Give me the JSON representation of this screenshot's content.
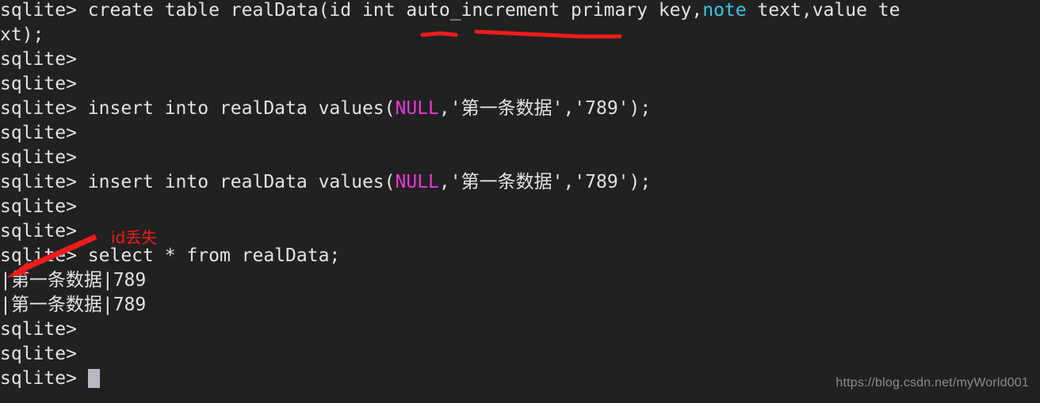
{
  "terminal": {
    "background_color": "#212121",
    "text_color": "#e3e3e3",
    "prompt": "sqlite>",
    "cursor": {
      "name": "text-cursor-block",
      "color": "#b8b8c4"
    },
    "colors": {
      "keyword_cyan": "#34c8e8",
      "literal_magenta": "#e838d8",
      "annotation_red": "#ee1c1c",
      "watermark_gray": "#8c8c8c"
    },
    "lines": [
      {
        "id": "line-1",
        "segments": [
          {
            "text": "sqlite> create table realData(id int auto_increment primary key,",
            "color": "plain"
          },
          {
            "text": "note",
            "color": "cyan"
          },
          {
            "text": " text,value te",
            "color": "plain"
          }
        ]
      },
      {
        "id": "line-2",
        "segments": [
          {
            "text": "xt);",
            "color": "plain"
          }
        ]
      },
      {
        "id": "line-3",
        "segments": [
          {
            "text": "sqlite>",
            "color": "plain"
          }
        ]
      },
      {
        "id": "line-4",
        "segments": [
          {
            "text": "sqlite>",
            "color": "plain"
          }
        ]
      },
      {
        "id": "line-5",
        "segments": [
          {
            "text": "sqlite> insert into realData values(",
            "color": "plain"
          },
          {
            "text": "NULL",
            "color": "magenta"
          },
          {
            "text": ",'第一条数据','789');",
            "color": "plain"
          }
        ]
      },
      {
        "id": "line-6",
        "segments": [
          {
            "text": "sqlite>",
            "color": "plain"
          }
        ]
      },
      {
        "id": "line-7",
        "segments": [
          {
            "text": "sqlite>",
            "color": "plain"
          }
        ]
      },
      {
        "id": "line-8",
        "segments": [
          {
            "text": "sqlite> insert into realData values(",
            "color": "plain"
          },
          {
            "text": "NULL",
            "color": "magenta"
          },
          {
            "text": ",'第一条数据','789');",
            "color": "plain"
          }
        ]
      },
      {
        "id": "line-9",
        "segments": [
          {
            "text": "sqlite>",
            "color": "plain"
          }
        ]
      },
      {
        "id": "line-10",
        "segments": [
          {
            "text": "sqlite>",
            "color": "plain"
          }
        ]
      },
      {
        "id": "line-11",
        "segments": [
          {
            "text": "sqlite> select * from realData;",
            "color": "plain"
          }
        ]
      },
      {
        "id": "line-12",
        "segments": [
          {
            "text": "|第一条数据|789",
            "color": "plain"
          }
        ]
      },
      {
        "id": "line-13",
        "segments": [
          {
            "text": "|第一条数据|789",
            "color": "plain"
          }
        ]
      },
      {
        "id": "line-14",
        "segments": [
          {
            "text": "sqlite>",
            "color": "plain"
          }
        ]
      },
      {
        "id": "line-15",
        "segments": [
          {
            "text": "sqlite>",
            "color": "plain"
          }
        ]
      },
      {
        "id": "line-16",
        "segments": [
          {
            "text": "sqlite> ",
            "color": "plain"
          }
        ],
        "cursor": true
      }
    ]
  },
  "annotations": {
    "underline_int": {
      "label": "red-underline-under-int"
    },
    "underline_auto_increment": {
      "label": "red-underline-under-auto-increment"
    },
    "id_lost_note": {
      "text": "id丢失"
    },
    "arrow": {
      "label": "red-arrow-pointing-to-empty-id-column"
    }
  },
  "watermark": {
    "text": "https://blog.csdn.net/myWorld001"
  }
}
